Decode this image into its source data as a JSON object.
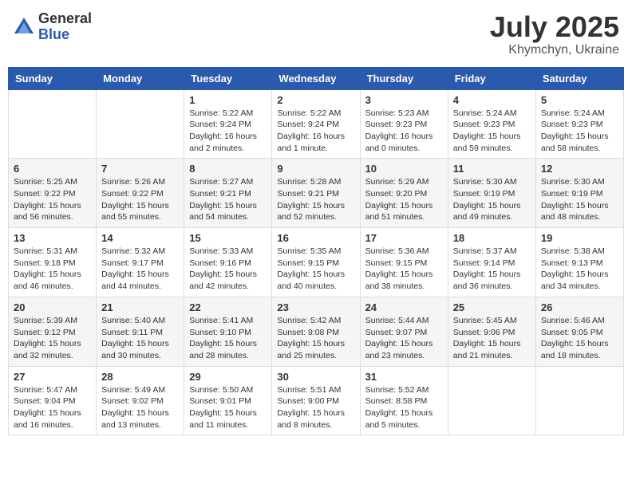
{
  "header": {
    "logo_general": "General",
    "logo_blue": "Blue",
    "month_year": "July 2025",
    "location": "Khymchyn, Ukraine"
  },
  "weekdays": [
    "Sunday",
    "Monday",
    "Tuesday",
    "Wednesday",
    "Thursday",
    "Friday",
    "Saturday"
  ],
  "weeks": [
    [
      {
        "day": "",
        "info": ""
      },
      {
        "day": "",
        "info": ""
      },
      {
        "day": "1",
        "info": "Sunrise: 5:22 AM\nSunset: 9:24 PM\nDaylight: 16 hours\nand 2 minutes."
      },
      {
        "day": "2",
        "info": "Sunrise: 5:22 AM\nSunset: 9:24 PM\nDaylight: 16 hours\nand 1 minute."
      },
      {
        "day": "3",
        "info": "Sunrise: 5:23 AM\nSunset: 9:23 PM\nDaylight: 16 hours\nand 0 minutes."
      },
      {
        "day": "4",
        "info": "Sunrise: 5:24 AM\nSunset: 9:23 PM\nDaylight: 15 hours\nand 59 minutes."
      },
      {
        "day": "5",
        "info": "Sunrise: 5:24 AM\nSunset: 9:23 PM\nDaylight: 15 hours\nand 58 minutes."
      }
    ],
    [
      {
        "day": "6",
        "info": "Sunrise: 5:25 AM\nSunset: 9:22 PM\nDaylight: 15 hours\nand 56 minutes."
      },
      {
        "day": "7",
        "info": "Sunrise: 5:26 AM\nSunset: 9:22 PM\nDaylight: 15 hours\nand 55 minutes."
      },
      {
        "day": "8",
        "info": "Sunrise: 5:27 AM\nSunset: 9:21 PM\nDaylight: 15 hours\nand 54 minutes."
      },
      {
        "day": "9",
        "info": "Sunrise: 5:28 AM\nSunset: 9:21 PM\nDaylight: 15 hours\nand 52 minutes."
      },
      {
        "day": "10",
        "info": "Sunrise: 5:29 AM\nSunset: 9:20 PM\nDaylight: 15 hours\nand 51 minutes."
      },
      {
        "day": "11",
        "info": "Sunrise: 5:30 AM\nSunset: 9:19 PM\nDaylight: 15 hours\nand 49 minutes."
      },
      {
        "day": "12",
        "info": "Sunrise: 5:30 AM\nSunset: 9:19 PM\nDaylight: 15 hours\nand 48 minutes."
      }
    ],
    [
      {
        "day": "13",
        "info": "Sunrise: 5:31 AM\nSunset: 9:18 PM\nDaylight: 15 hours\nand 46 minutes."
      },
      {
        "day": "14",
        "info": "Sunrise: 5:32 AM\nSunset: 9:17 PM\nDaylight: 15 hours\nand 44 minutes."
      },
      {
        "day": "15",
        "info": "Sunrise: 5:33 AM\nSunset: 9:16 PM\nDaylight: 15 hours\nand 42 minutes."
      },
      {
        "day": "16",
        "info": "Sunrise: 5:35 AM\nSunset: 9:15 PM\nDaylight: 15 hours\nand 40 minutes."
      },
      {
        "day": "17",
        "info": "Sunrise: 5:36 AM\nSunset: 9:15 PM\nDaylight: 15 hours\nand 38 minutes."
      },
      {
        "day": "18",
        "info": "Sunrise: 5:37 AM\nSunset: 9:14 PM\nDaylight: 15 hours\nand 36 minutes."
      },
      {
        "day": "19",
        "info": "Sunrise: 5:38 AM\nSunset: 9:13 PM\nDaylight: 15 hours\nand 34 minutes."
      }
    ],
    [
      {
        "day": "20",
        "info": "Sunrise: 5:39 AM\nSunset: 9:12 PM\nDaylight: 15 hours\nand 32 minutes."
      },
      {
        "day": "21",
        "info": "Sunrise: 5:40 AM\nSunset: 9:11 PM\nDaylight: 15 hours\nand 30 minutes."
      },
      {
        "day": "22",
        "info": "Sunrise: 5:41 AM\nSunset: 9:10 PM\nDaylight: 15 hours\nand 28 minutes."
      },
      {
        "day": "23",
        "info": "Sunrise: 5:42 AM\nSunset: 9:08 PM\nDaylight: 15 hours\nand 25 minutes."
      },
      {
        "day": "24",
        "info": "Sunrise: 5:44 AM\nSunset: 9:07 PM\nDaylight: 15 hours\nand 23 minutes."
      },
      {
        "day": "25",
        "info": "Sunrise: 5:45 AM\nSunset: 9:06 PM\nDaylight: 15 hours\nand 21 minutes."
      },
      {
        "day": "26",
        "info": "Sunrise: 5:46 AM\nSunset: 9:05 PM\nDaylight: 15 hours\nand 18 minutes."
      }
    ],
    [
      {
        "day": "27",
        "info": "Sunrise: 5:47 AM\nSunset: 9:04 PM\nDaylight: 15 hours\nand 16 minutes."
      },
      {
        "day": "28",
        "info": "Sunrise: 5:49 AM\nSunset: 9:02 PM\nDaylight: 15 hours\nand 13 minutes."
      },
      {
        "day": "29",
        "info": "Sunrise: 5:50 AM\nSunset: 9:01 PM\nDaylight: 15 hours\nand 11 minutes."
      },
      {
        "day": "30",
        "info": "Sunrise: 5:51 AM\nSunset: 9:00 PM\nDaylight: 15 hours\nand 8 minutes."
      },
      {
        "day": "31",
        "info": "Sunrise: 5:52 AM\nSunset: 8:58 PM\nDaylight: 15 hours\nand 5 minutes."
      },
      {
        "day": "",
        "info": ""
      },
      {
        "day": "",
        "info": ""
      }
    ]
  ]
}
